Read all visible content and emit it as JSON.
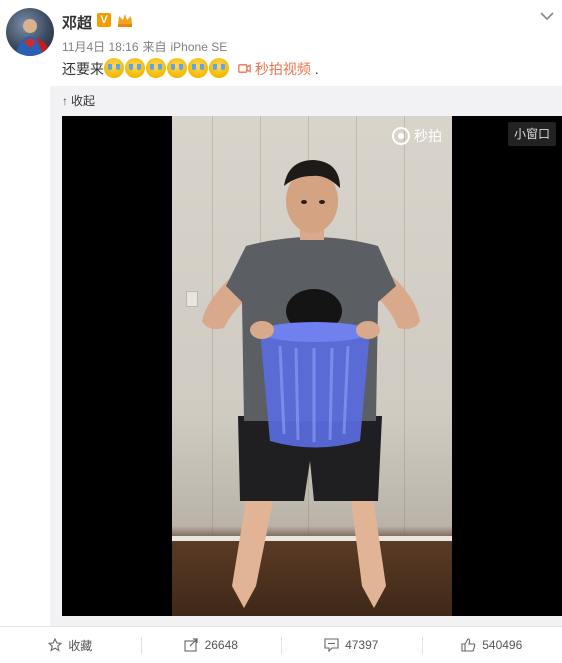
{
  "post": {
    "username": "邓超",
    "vip_badge": "V",
    "timestamp": "11月4日 18:16",
    "source_prefix": "来自",
    "source": "iPhone SE",
    "text": "还要来",
    "emoji_count": 6,
    "video_link_label": "秒拍视频",
    "trailing": "."
  },
  "panel": {
    "collapse_label": "收起"
  },
  "video": {
    "watermark": "秒拍",
    "mini_window_label": "小窗口"
  },
  "actions": {
    "favorite_label": "收藏",
    "repost_count": "26648",
    "comment_count": "47397",
    "like_count": "540496"
  },
  "colors": {
    "link": "#eb7350",
    "muted": "#808080",
    "panel_bg": "#f2f2f5"
  }
}
